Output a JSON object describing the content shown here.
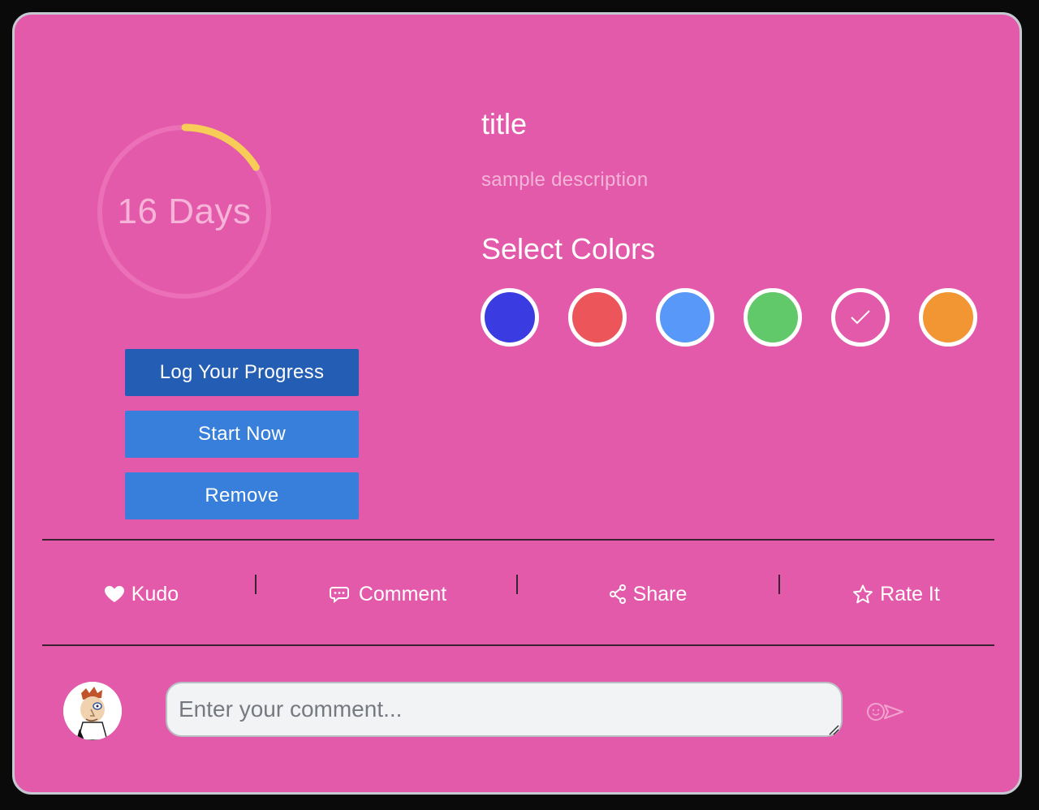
{
  "progress": {
    "label": "16 Days",
    "fraction": 0.16,
    "track_color": "#eb70b7",
    "arc_color": "#f7cd58"
  },
  "buttons": {
    "log_progress": "Log Your Progress",
    "start_now": "Start Now",
    "remove": "Remove"
  },
  "item": {
    "title": "title",
    "description": "sample description"
  },
  "colors": {
    "heading": "Select Colors",
    "swatches": [
      {
        "color": "#3b3be2",
        "selected": false
      },
      {
        "color": "#ec5559",
        "selected": false
      },
      {
        "color": "#5898f8",
        "selected": false
      },
      {
        "color": "#62c96a",
        "selected": false
      },
      {
        "color": "#e35aaa",
        "selected": true
      },
      {
        "color": "#f29533",
        "selected": false
      }
    ]
  },
  "actions": [
    {
      "label": "Kudo",
      "icon": "heart-icon"
    },
    {
      "label": "Comment",
      "icon": "comment-icon"
    },
    {
      "label": "Share",
      "icon": "share-icon"
    },
    {
      "label": "Rate It",
      "icon": "star-icon"
    }
  ],
  "comment": {
    "placeholder": "Enter your comment...",
    "send_icon": "send-icon",
    "avatar_icon": "cartoon-avatar"
  },
  "theme": {
    "card_background": "#e35aaa",
    "primary_button": "#235eb4",
    "secondary_button": "#377fda"
  }
}
